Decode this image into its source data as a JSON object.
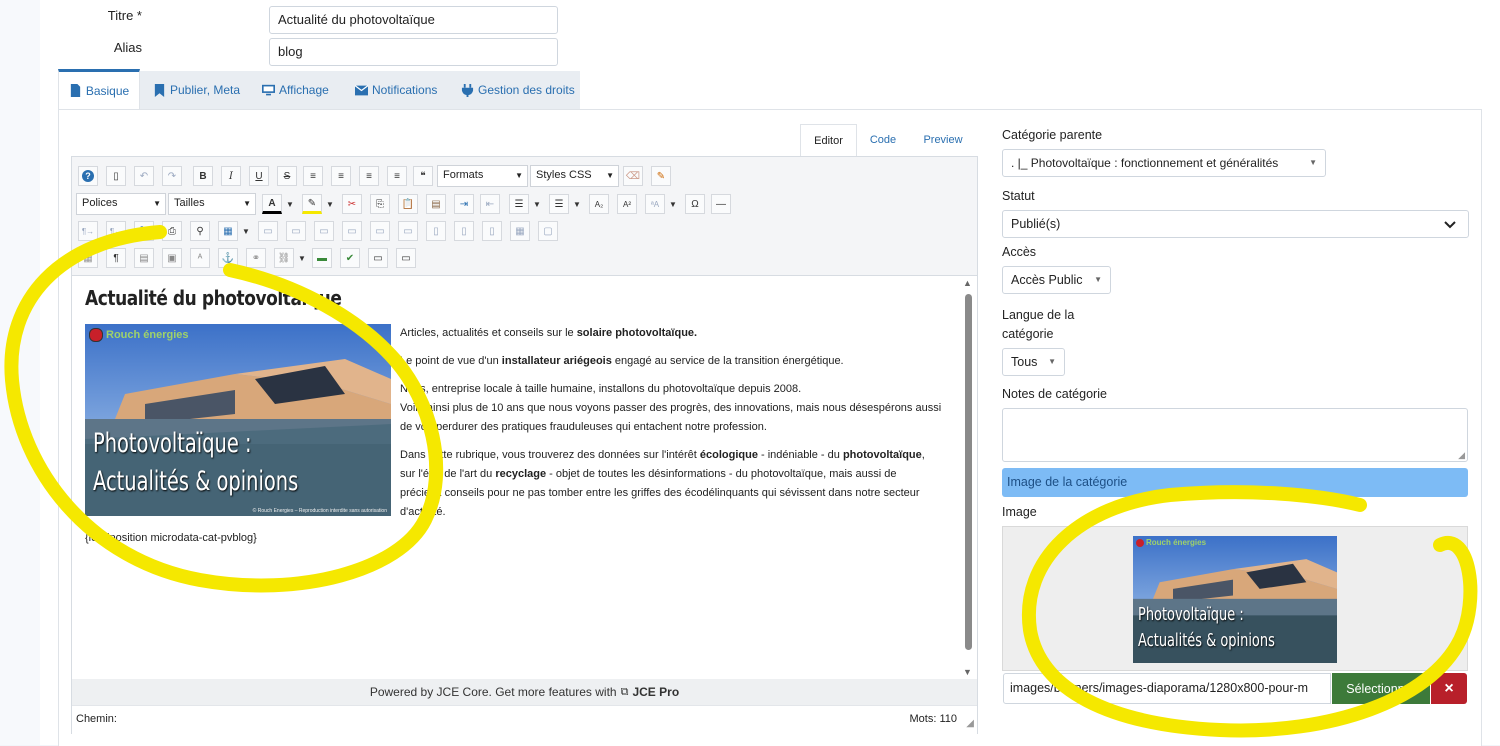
{
  "form": {
    "title_label": "Titre *",
    "title_value": "Actualité du photovoltaïque",
    "alias_label": "Alias",
    "alias_value": "blog"
  },
  "tabs": [
    {
      "label": "Basique",
      "icon": "file-icon"
    },
    {
      "label": "Publier, Meta",
      "icon": "bookmark-icon"
    },
    {
      "label": "Affichage",
      "icon": "monitor-icon"
    },
    {
      "label": "Notifications",
      "icon": "envelope-icon"
    },
    {
      "label": "Gestion des droits",
      "icon": "plug-icon"
    }
  ],
  "editor": {
    "tabs": [
      "Editor",
      "Code",
      "Preview"
    ],
    "toolbar": {
      "formats": "Formats",
      "styles": "Styles CSS",
      "fonts": "Polices",
      "sizes": "Tailles"
    },
    "content": {
      "heading": "Actualité du photovoltaïque",
      "image_brand": "Rouch énergies",
      "image_title_line1": "Photovoltaïque :",
      "image_title_line2": "Actualités & opinions",
      "image_credit": "© Rouch Energies – Reproduction interdite sans autorisation",
      "p1_a": "Articles, actualités et conseils sur le ",
      "p1_b": "solaire photovoltaïque.",
      "p2_a": "Le point de vue d'un ",
      "p2_b": "installateur ariégeois",
      "p2_c": " engagé au service de la transition énergétique.",
      "p3_l1": "Nous, entreprise locale à taille humaine, installons du photovoltaïque depuis 2008.",
      "p3_l2": "Voilà ainsi plus de 10 ans que nous voyons passer des progrès, des innovations, mais nous désespérons aussi",
      "p3_l3": "de voir perdurer des pratiques frauduleuses qui entachent notre profession.",
      "p4_a": "Dans cette rubrique, vous trouverez des données sur l'intérêt ",
      "p4_b": "écologique",
      "p4_c": " - indéniable - du ",
      "p4_d": "photovoltaïque",
      "p4_e": ",",
      "p4_f": "sur l'état de l'art du ",
      "p4_g": "recyclage",
      "p4_h": " - objet de toutes les désinformations - du photovoltaïque, mais aussi de",
      "p4_i": "précieux conseils pour ne pas tomber entre les griffes des écodélinquants qui sévissent dans notre secteur",
      "p4_j": "d'activité.",
      "loadposition": "{loadposition microdata-cat-pvblog}"
    },
    "powered_text": "Powered by JCE Core. Get more features with",
    "powered_link": "JCE Pro",
    "path_label": "Chemin:",
    "words_label": "Mots: 110"
  },
  "right_panel": {
    "parent_label": "Catégorie parente",
    "parent_value": ". |_ Photovoltaïque : fonctionnement et généralités",
    "status_label": "Statut",
    "status_value": "Publié(s)",
    "access_label": "Accès",
    "access_value": "Accès Public",
    "language_label_1": "Langue de la",
    "language_label_2": "catégorie",
    "language_value": "Tous",
    "notes_label": "Notes de catégorie",
    "image_section": "Image de la catégorie",
    "image_label": "Image",
    "image_path": "images/banners/images-diaporama/1280x800-pour-m",
    "select_button": "Sélectionner",
    "clear_button": "×"
  },
  "colors": {
    "accent": "#2a6fb0",
    "highlight": "#f5e800",
    "select_button": "#3d7a3a",
    "clear_button": "#b8202a",
    "section_bar": "#7dbbf5"
  }
}
